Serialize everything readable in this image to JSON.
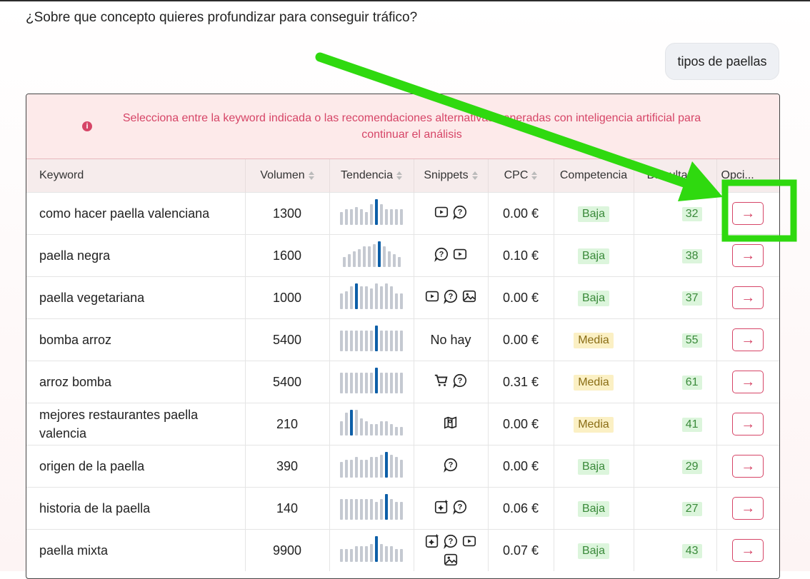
{
  "chat": {
    "question": "¿Sobre que concepto quieres profundizar para conseguir tráfico?",
    "user_message": "tipos de paellas"
  },
  "alert": {
    "icon": "info-icon",
    "text": "Selecciona entre la keyword indicada o las recomendaciones alternativas generadas con inteligencia artificial para continuar el análisis"
  },
  "table": {
    "headers": {
      "keyword": "Keyword",
      "volumen": "Volumen",
      "tendencia": "Tendencia",
      "snippets": "Snippets",
      "cpc": "CPC",
      "competencia": "Competencia",
      "dificultad": "Dificultad",
      "opciones": "Opci..."
    },
    "rows": [
      {
        "keyword": "como hacer paella valenciana",
        "volumen": "1300",
        "trend": [
          5,
          6,
          6,
          7,
          6,
          5,
          8,
          10,
          8,
          6,
          6,
          6,
          6
        ],
        "snippets": [
          "video-icon",
          "question-icon"
        ],
        "cpc": "0.00 €",
        "competencia": "Baja",
        "dificultad": "32"
      },
      {
        "keyword": "paella negra",
        "volumen": "1600",
        "trend": [
          4,
          5,
          6,
          7,
          8,
          8,
          9,
          10,
          8,
          6,
          5,
          4
        ],
        "snippets": [
          "question-icon",
          "video-icon"
        ],
        "cpc": "0.10 €",
        "competencia": "Baja",
        "dificultad": "38"
      },
      {
        "keyword": "paella vegetariana",
        "volumen": "1000",
        "trend": [
          6,
          7,
          9,
          10,
          9,
          9,
          8,
          10,
          9,
          10,
          9,
          6,
          6
        ],
        "snippets": [
          "video-icon",
          "question-icon",
          "image-icon"
        ],
        "cpc": "0.00 €",
        "competencia": "Baja",
        "dificultad": "37"
      },
      {
        "keyword": "bomba arroz",
        "volumen": "5400",
        "trend": [
          8,
          8,
          8,
          8,
          8,
          8,
          8,
          10,
          8,
          8,
          8,
          8,
          8
        ],
        "snippets": [],
        "snippets_text": "No hay",
        "cpc": "0.00 €",
        "competencia": "Media",
        "dificultad": "55"
      },
      {
        "keyword": "arroz bomba",
        "volumen": "5400",
        "trend": [
          8,
          8,
          8,
          8,
          8,
          8,
          8,
          10,
          8,
          8,
          8,
          8,
          8
        ],
        "snippets": [
          "cart-icon",
          "question-icon"
        ],
        "cpc": "0.31 €",
        "competencia": "Media",
        "dificultad": "61"
      },
      {
        "keyword": "mejores restaurantes paella valencia",
        "volumen": "210",
        "trend": [
          5,
          8,
          9,
          9,
          6,
          5,
          4,
          4,
          5,
          5,
          4,
          3,
          3
        ],
        "snippets": [
          "map-icon"
        ],
        "cpc": "0.00 €",
        "competencia": "Media",
        "dificultad": "41"
      },
      {
        "keyword": "origen de la paella",
        "volumen": "390",
        "trend": [
          6,
          7,
          7,
          8,
          7,
          7,
          8,
          8,
          9,
          10,
          9,
          8,
          7
        ],
        "snippets": [
          "question-icon"
        ],
        "cpc": "0.00 €",
        "competencia": "Baja",
        "dificultad": "29"
      },
      {
        "keyword": "historia de la paella",
        "volumen": "140",
        "trend": [
          8,
          8,
          8,
          8,
          8,
          8,
          8,
          7,
          8,
          10,
          8,
          7,
          7
        ],
        "snippets": [
          "sparkle-image-icon",
          "question-icon"
        ],
        "cpc": "0.06 €",
        "competencia": "Baja",
        "dificultad": "27"
      },
      {
        "keyword": "paella mixta",
        "volumen": "9900",
        "trend": [
          5,
          5,
          5,
          6,
          6,
          6,
          7,
          10,
          7,
          6,
          6,
          5,
          5
        ],
        "snippets": [
          "sparkle-image-icon",
          "question-icon",
          "video-icon",
          "image-icon"
        ],
        "cpc": "0.07 €",
        "competencia": "Baja",
        "dificultad": "43"
      }
    ],
    "action_icon": "arrow-right-icon"
  },
  "annotation": {
    "arrow_color": "#2fd90f",
    "highlight_color": "#2fd90f"
  },
  "colors": {
    "accent": "#d64567",
    "trend_bar": "#c5c9d1",
    "trend_current": "#0d5fa8",
    "baja_bg": "#dcf5dc",
    "media_bg": "#fbf0c4"
  }
}
